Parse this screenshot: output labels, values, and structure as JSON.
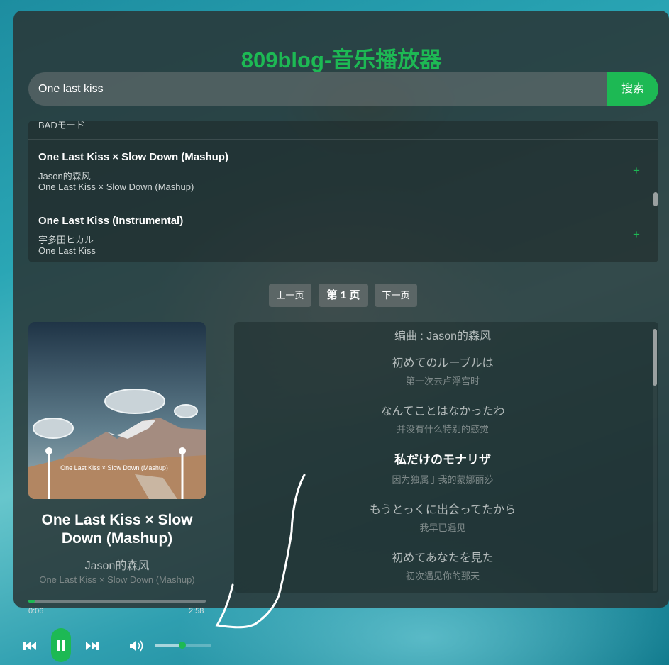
{
  "app_title": "809blog-音乐播放器",
  "search": {
    "value": "One last kiss",
    "button_label": "搜索"
  },
  "results": {
    "partial_label": "BADモード",
    "items": [
      {
        "title": "One Last Kiss × Slow Down (Mashup)",
        "artist": "Jason的森风",
        "album": "One Last Kiss × Slow Down (Mashup)",
        "add_icon": "+"
      },
      {
        "title": "One Last Kiss (Instrumental)",
        "artist": "宇多田ヒカル",
        "album": "One Last Kiss",
        "add_icon": "+"
      }
    ]
  },
  "pagination": {
    "prev_label": "上一页",
    "current_label": "第 1 页",
    "next_label": "下一页"
  },
  "now_playing": {
    "cover_caption": "One Last Kiss × Slow Down (Mashup)",
    "title": "One Last Kiss × Slow Down (Mashup)",
    "artist": "Jason的森风",
    "album": "One Last Kiss × Slow Down (Mashup)"
  },
  "lyrics": {
    "credit": "编曲 : Jason的森风",
    "lines": [
      {
        "original": "初めてのルーブルは",
        "translation": "第一次去卢浮宫时",
        "current": false
      },
      {
        "original": "なんてことはなかったわ",
        "translation": "并没有什么特别的感觉",
        "current": false
      },
      {
        "original": "私だけのモナリザ",
        "translation": "因为独属于我的蒙娜丽莎",
        "current": true
      },
      {
        "original": "もうとっくに出会ってたから",
        "translation": "我早已遇见",
        "current": false
      },
      {
        "original": "初めてあなたを見た",
        "translation": "初次遇见你的那天",
        "current": false
      }
    ]
  },
  "playback": {
    "elapsed": "0:06",
    "duration": "2:58",
    "progress_fraction": 0.034,
    "volume_fraction": 0.45,
    "is_playing": true
  },
  "colors": {
    "accent": "#1db954",
    "panel": "#2a3232",
    "text_muted": "#b8c0c0"
  },
  "icons": {
    "prev": "previous-track-icon",
    "play": "pause-icon",
    "next": "next-track-icon",
    "volume": "speaker-icon",
    "add": "plus-icon"
  }
}
